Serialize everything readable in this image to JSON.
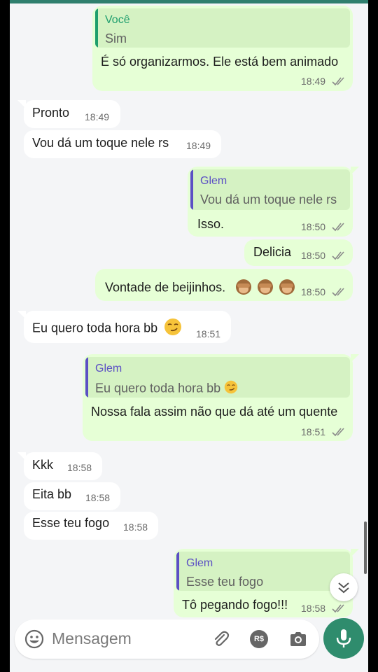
{
  "colors": {
    "outgoing_bubble": "#e6ffd6",
    "incoming_bubble": "#ffffff",
    "quote_name_self": "#1e9e6d",
    "quote_name_contact": "#5b4fc4",
    "accent": "#2f8c6d"
  },
  "messages": [
    {
      "dir": "out",
      "quote": {
        "name": "Você",
        "text": "Sim"
      },
      "text": "É só organizarmos. Ele está bem animado",
      "time": "18:49",
      "status": "read"
    },
    {
      "dir": "in",
      "text": "Pronto",
      "time": "18:49"
    },
    {
      "dir": "in",
      "text": "Vou dá um toque nele rs",
      "time": "18:49"
    },
    {
      "dir": "out",
      "quote": {
        "name": "Glem",
        "text": "Vou dá um toque nele rs"
      },
      "text": "Isso.",
      "time": "18:50",
      "status": "read"
    },
    {
      "dir": "out",
      "text": "Delicia",
      "time": "18:50",
      "status": "read"
    },
    {
      "dir": "out",
      "text": "Vontade de beijinhos.",
      "emoji": [
        "see-no-evil-monkey",
        "see-no-evil-monkey",
        "see-no-evil-monkey"
      ],
      "time": "18:50",
      "status": "read"
    },
    {
      "dir": "in",
      "text": "Eu quero toda hora bb",
      "emoji": [
        "smirking-face"
      ],
      "time": "18:51"
    },
    {
      "dir": "out",
      "quote": {
        "name": "Glem",
        "text": "Eu quero toda hora bb",
        "emoji": "smirking-face"
      },
      "text": "Nossa fala assim não que dá até um quente",
      "time": "18:51",
      "status": "read"
    },
    {
      "dir": "in",
      "text": "Kkk",
      "time": "18:58"
    },
    {
      "dir": "in",
      "text": "Eita bb",
      "time": "18:58"
    },
    {
      "dir": "in",
      "text": "Esse teu fogo",
      "time": "18:58"
    },
    {
      "dir": "out",
      "quote": {
        "name": "Glem",
        "text": "Esse teu fogo"
      },
      "text": "Tô pegando fogo!!!",
      "time": "18:58",
      "status": "read"
    }
  ],
  "composer": {
    "placeholder": "Mensagem",
    "icons": [
      "emoji-icon",
      "attach-icon",
      "payment-icon",
      "camera-icon",
      "mic-icon"
    ],
    "payment_label": "R$"
  },
  "scroll_down_icon": "double-chevron-down-icon"
}
